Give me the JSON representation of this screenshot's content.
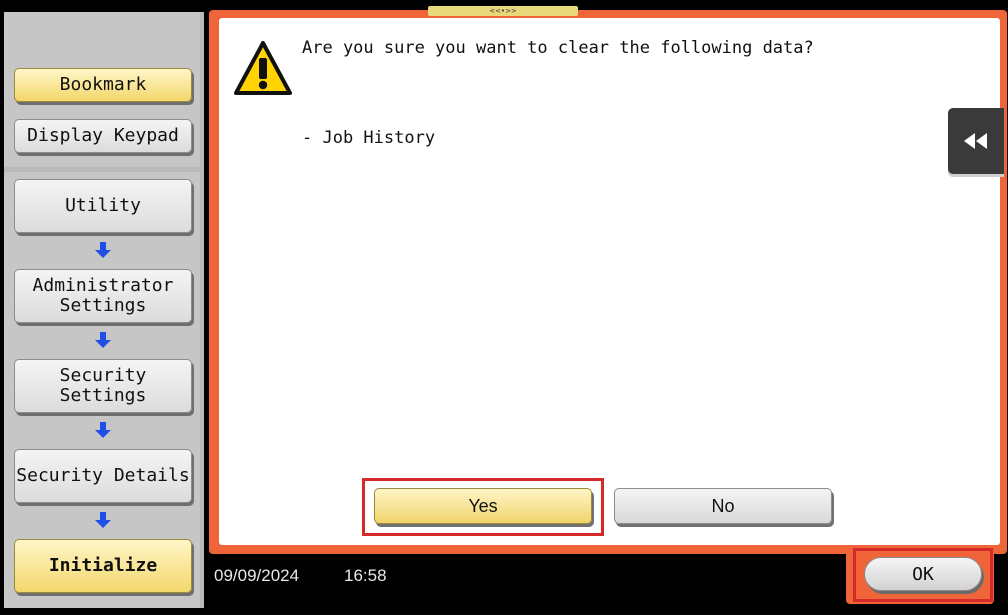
{
  "sidebar": {
    "bookmark_label": "Bookmark",
    "display_keypad_label": "Display Keypad",
    "path": [
      {
        "label": "Utility"
      },
      {
        "label": "Administrator\nSettings"
      },
      {
        "label": "Security\nSettings"
      },
      {
        "label": "Security Details"
      },
      {
        "label": "Initialize"
      }
    ]
  },
  "dialog": {
    "question": "Are you sure you want to clear the following data?",
    "detail": "- Job History",
    "yes_label": "Yes",
    "no_label": "No"
  },
  "top_handle_label": "<<•>>",
  "status": {
    "date": "09/09/2024",
    "time": "16:58"
  },
  "ok_label": "OK",
  "colors": {
    "accent_frame": "#f0643a",
    "highlight_outline": "#d42a2a",
    "selected_button": "#f3d76b",
    "arrow": "#1e50e6"
  },
  "icons": {
    "warning": "warning-icon",
    "collapse": "double-chevron-left-icon",
    "path_arrow": "arrow-down-icon"
  }
}
